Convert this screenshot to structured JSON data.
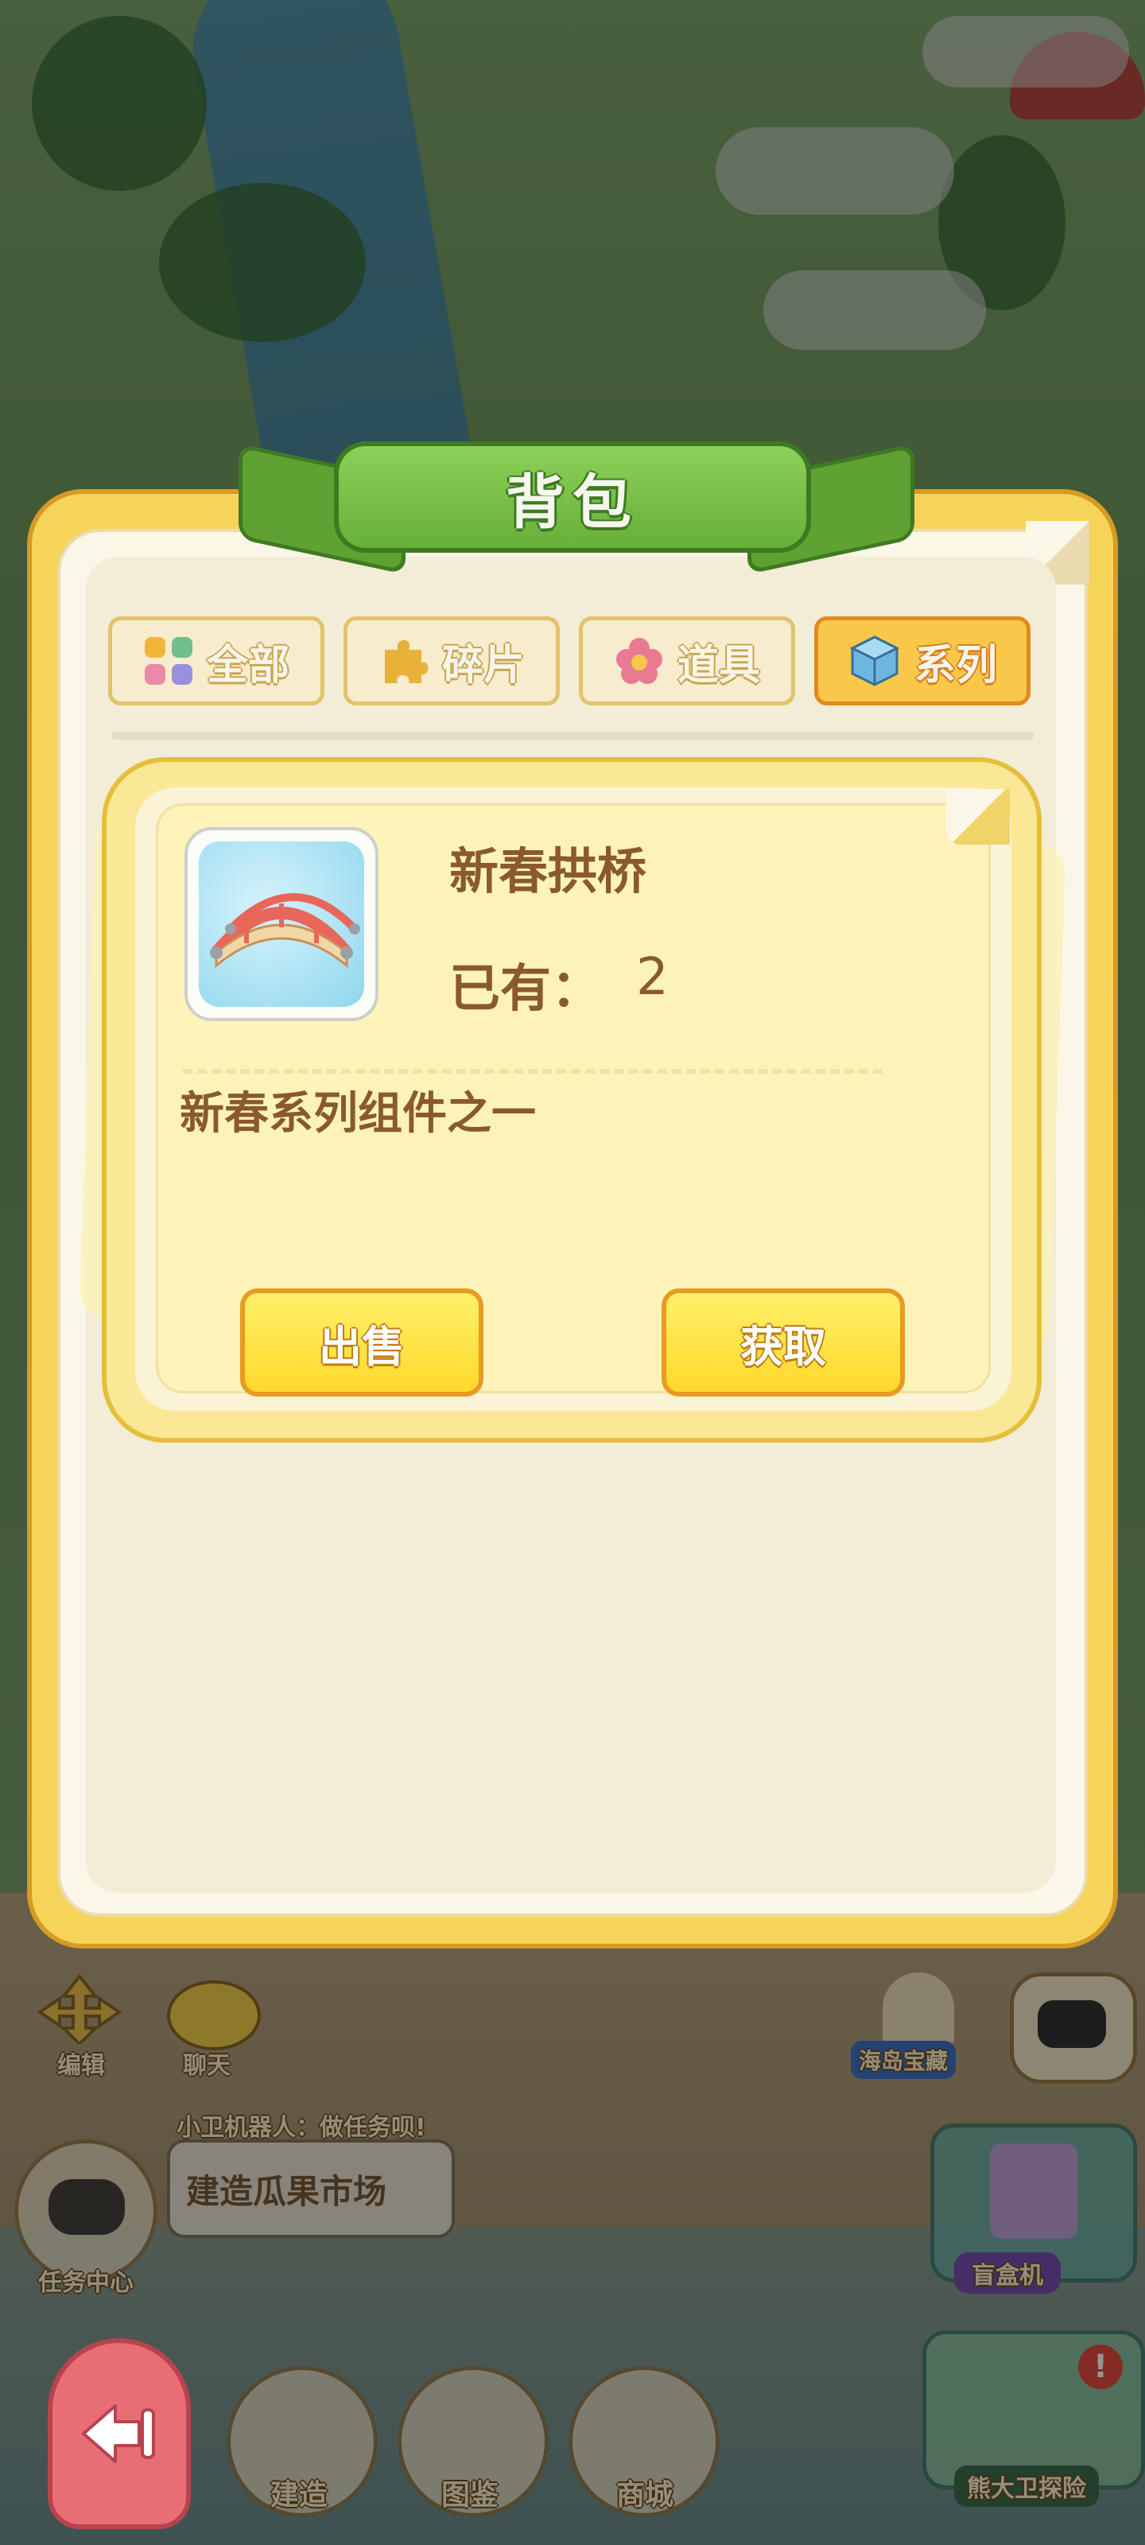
{
  "panel": {
    "title": "背包",
    "tabs": [
      {
        "label": "全部",
        "icon": "grid-icon",
        "active": false
      },
      {
        "label": "碎片",
        "icon": "puzzle-icon",
        "active": false
      },
      {
        "label": "道具",
        "icon": "flower-icon",
        "active": false
      },
      {
        "label": "系列",
        "icon": "cube-icon",
        "active": true
      }
    ]
  },
  "item_detail": {
    "name": "新春拱桥",
    "owned_label": "已有：",
    "owned_count": "2",
    "description": "新春系列组件之一",
    "sell_label": "出售",
    "obtain_label": "获取"
  },
  "hud": {
    "edit_label": "编辑",
    "chat_label": "聊天",
    "robot_hint": "小卫机器人：做任务呗!",
    "robot_task": "建造瓜果市场",
    "task_center_label": "任务中心",
    "island_treasure_label": "海岛宝藏",
    "blind_box_label": "盲盒机",
    "build_label": "建造",
    "atlas_label": "图鉴",
    "shop_label": "商城",
    "explore_label": "熊大卫探险"
  },
  "colors": {
    "panel_yellow": "#f6d45a",
    "ribbon_green": "#67b03a",
    "text_brown": "#8a5a2b",
    "button_yellow": "#ffd92a",
    "exit_red": "#e96d75"
  }
}
